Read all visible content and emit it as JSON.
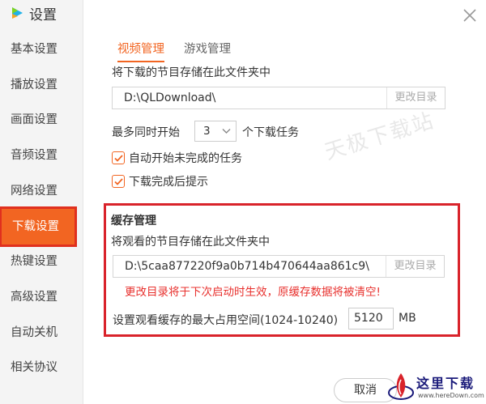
{
  "window": {
    "title": "设置",
    "close_icon": "close-icon"
  },
  "sidebar": {
    "items": [
      {
        "label": "基本设置"
      },
      {
        "label": "播放设置"
      },
      {
        "label": "画面设置"
      },
      {
        "label": "音频设置"
      },
      {
        "label": "网络设置"
      },
      {
        "label": "下载设置",
        "active": true
      },
      {
        "label": "热键设置"
      },
      {
        "label": "高级设置"
      },
      {
        "label": "自动关机"
      },
      {
        "label": "相关协议"
      }
    ]
  },
  "tabs": [
    {
      "label": "视频管理",
      "active": true
    },
    {
      "label": "游戏管理"
    }
  ],
  "download": {
    "folder_label": "将下载的节目存储在此文件夹中",
    "folder_path": "D:\\QLDownload\\",
    "change_dir_label": "更改目录",
    "max_label_prefix": "最多同时开始",
    "max_value": "3",
    "max_label_suffix": "个下载任务",
    "auto_start_label": "自动开始未完成的任务",
    "auto_start_checked": true,
    "notify_label": "下载完成后提示",
    "notify_checked": true
  },
  "cache": {
    "title": "缓存管理",
    "folder_label": "将观看的节目存储在此文件夹中",
    "folder_path": "D:\\5caa877220f9a0b714b470644aa861c9\\",
    "change_dir_label": "更改目录",
    "warning": "更改目录将于下次启动时生效，原缓存数据将被清空!",
    "max_size_label": "设置观看缓存的最大占用空间(1024-10240)",
    "max_size_value": "5120",
    "unit": "MB"
  },
  "footer": {
    "cancel_label": "取消"
  },
  "watermark": {
    "text": "天极下载站"
  },
  "brand": {
    "name": "这里下载",
    "url": "www.hereDown.com"
  },
  "colors": {
    "accent": "#f26522",
    "alert": "#e8312e",
    "highlight_border": "#d9232b"
  }
}
